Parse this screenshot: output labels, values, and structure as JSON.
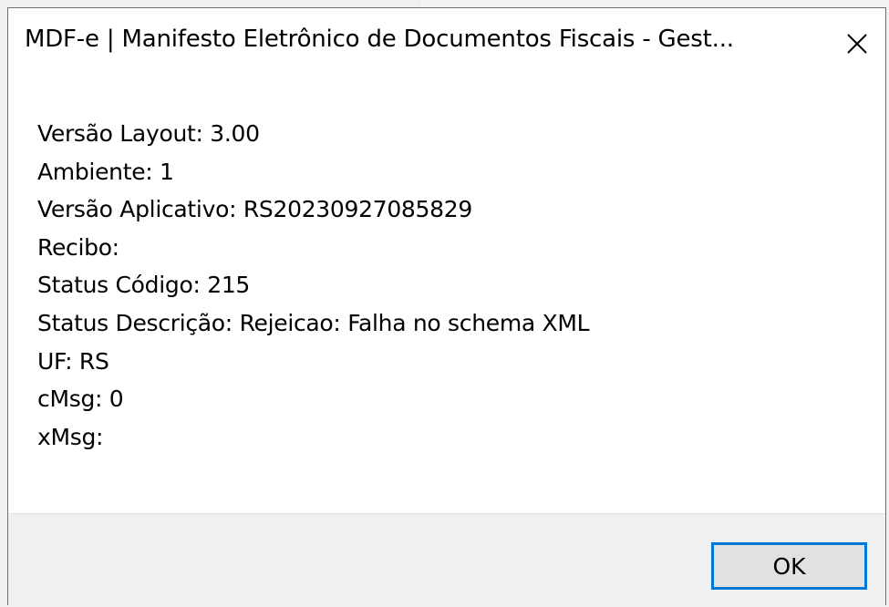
{
  "dialog": {
    "title": "MDF-e | Manifesto Eletrônico de Documentos Fiscais - Gest...",
    "close_icon": "close-icon",
    "lines": [
      "Versão Layout: 3.00",
      "Ambiente: 1",
      "Versão Aplicativo: RS20230927085829",
      "Recibo:",
      "Status Código: 215",
      "Status Descrição: Rejeicao: Falha no schema XML",
      "UF: RS",
      "cMsg: 0",
      "xMsg:"
    ],
    "ok_label": "OK"
  },
  "colors": {
    "button_focus_border": "#0078d7",
    "footer_bg": "#f0f0f0",
    "dialog_bg": "#ffffff"
  }
}
